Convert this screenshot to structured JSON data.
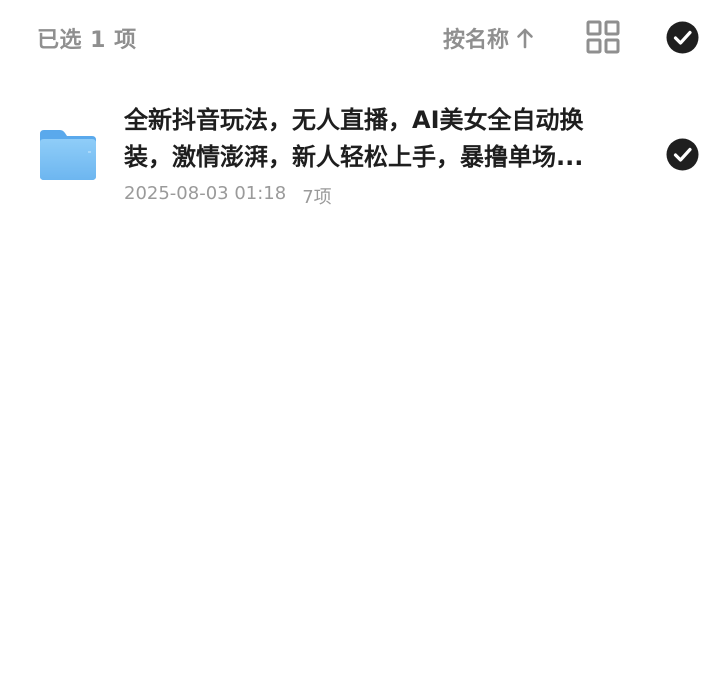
{
  "header": {
    "selected_label": "已选 1 项",
    "sort_label": "按名称",
    "sort_icon": "arrow-up-icon",
    "view_toggle_icon": "grid-view-icon",
    "select_all_icon": "check-circle-icon"
  },
  "files": [
    {
      "icon": "folder-icon",
      "name": "全新抖音玩法，无人直播，AI美女全自动换装，激情澎湃，新人轻松上手，暴撸单场...",
      "date": "2025-08-03 01:18",
      "count": "7项",
      "selected": true,
      "check_icon": "check-circle-icon"
    }
  ],
  "colors": {
    "muted_text": "#8f8f8f",
    "primary_text": "#1e1e1e",
    "meta_text": "#9a9a9a",
    "check_fill": "#1f1f1f",
    "folder_blue": "#7cc0f4"
  }
}
